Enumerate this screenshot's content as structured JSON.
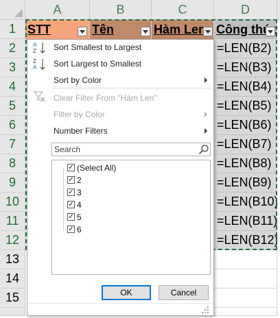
{
  "sheet": {
    "columns": [
      "A",
      "B",
      "C",
      "D"
    ],
    "rows": [
      "1",
      "2",
      "3",
      "4",
      "5",
      "6",
      "7",
      "8",
      "9",
      "10",
      "11",
      "12",
      "13",
      "14",
      "15"
    ],
    "header_row": {
      "a": "STT",
      "b": "Tên",
      "c": "Hàm Len",
      "d": "Công thức"
    },
    "formulas": [
      "=LEN(B2)",
      "=LEN(B3)",
      "=LEN(B4)",
      "=LEN(B5)",
      "=LEN(B6)",
      "=LEN(B7)",
      "=LEN(B8)",
      "=LEN(B9)",
      "=LEN(B10)",
      "=LEN(B11)",
      "=LEN(B12)"
    ],
    "colors": {
      "header_a_fill": "#f4a57c",
      "header_bc_fill": "#c08a6a",
      "header_d_fill": "#bfbfbf",
      "selection_border": "#217346"
    }
  },
  "filter_menu": {
    "sort_asc": "Sort Smallest to Largest",
    "sort_desc": "Sort Largest to Smallest",
    "sort_color": "Sort by Color",
    "clear_filter": "Clear Filter From \"Hàm Len\"",
    "filter_color": "Filter by Color",
    "number_filters": "Number Filters",
    "search_placeholder": "Search",
    "items": [
      "(Select All)",
      "2",
      "3",
      "4",
      "5",
      "6"
    ],
    "ok_label": "OK",
    "cancel_label": "Cancel",
    "icons": {
      "sort_asc": "sort-ascending-icon",
      "sort_desc": "sort-descending-icon",
      "clear_filter": "clear-filter-icon",
      "search": "search-icon"
    }
  }
}
